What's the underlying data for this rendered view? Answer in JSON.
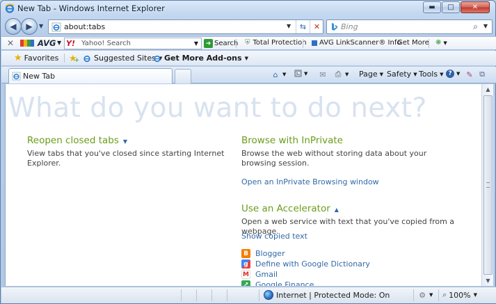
{
  "window": {
    "title": "New Tab - Windows Internet Explorer",
    "minimize_label": "▬",
    "maximize_label": "□",
    "close_label": "✕"
  },
  "address_bar": {
    "url": "about:tabs",
    "search_placeholder": "Bing"
  },
  "avg_toolbar": {
    "brand": "AVG",
    "yahoo_logo": "Y!",
    "search_text": "Yahoo! Search",
    "search_button": "Search",
    "total_protection": "Total Protection",
    "linkscanner": "AVG LinkScanner® Info",
    "get_more": "Get More"
  },
  "favorites_bar": {
    "favorites_label": "Favorites",
    "items": [
      {
        "label": "Suggested Sites"
      },
      {
        "label": "Get More Add-ons"
      }
    ]
  },
  "tabs": [
    {
      "label": "New Tab"
    }
  ],
  "command_bar": {
    "page": "Page",
    "safety": "Safety",
    "tools": "Tools",
    "help_icon": "?"
  },
  "content": {
    "headline": "What do you want to do next?",
    "reopen": {
      "title": "Reopen closed tabs",
      "desc": "View tabs that you've closed since starting Internet Explorer."
    },
    "inprivate": {
      "title": "Browse with InPrivate",
      "desc": "Browse the web without storing data about your browsing session.",
      "link": "Open an InPrivate Browsing window"
    },
    "accelerator": {
      "title": "Use an Accelerator",
      "desc": "Open a web service with text that you've copied from a webpage.",
      "link": "Show copied text",
      "items": [
        {
          "label": "Blogger",
          "icon_letter": "B",
          "color": "#f57d00"
        },
        {
          "label": "Define with Google Dictionary",
          "icon_letter": "g",
          "color": "#4285f4"
        },
        {
          "label": "Gmail",
          "icon_letter": "M",
          "color": "#d93025"
        },
        {
          "label": "Google Finance",
          "icon_letter": "↗",
          "color": "#34a853"
        }
      ]
    }
  },
  "status_bar": {
    "zone": "Internet | Protected Mode: On",
    "zoom": "100%"
  },
  "colors": {
    "heading_green": "#6a9d1a",
    "link_blue": "#3269a8",
    "headline_grey": "#d8e2ef"
  }
}
